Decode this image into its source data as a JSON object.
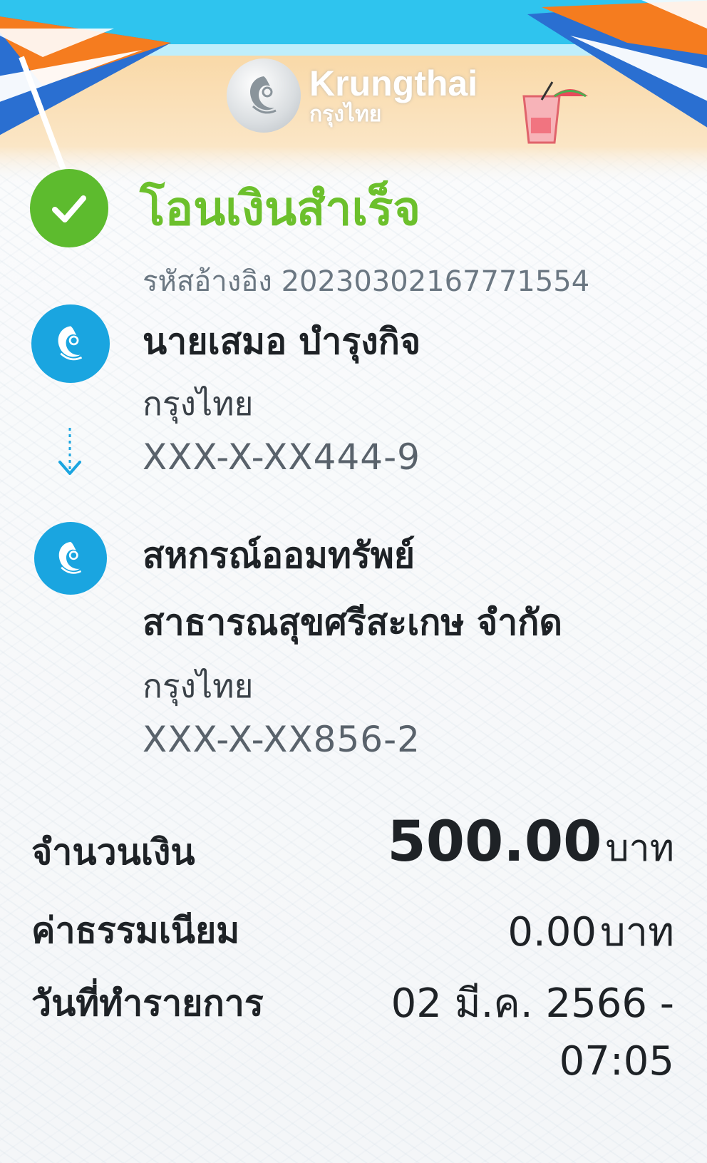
{
  "brand": {
    "name_en": "Krungthai",
    "name_th": "กรุงไทย"
  },
  "status": {
    "title": "โอนเงินสำเร็จ",
    "ref_label": "รหัสอ้างอิง",
    "ref_number": "20230302167771554"
  },
  "sender": {
    "name": "นายเสมอ บำรุงกิจ",
    "bank": "กรุงไทย",
    "account": "XXX-X-XX444-9"
  },
  "receiver": {
    "name_line1": "สหกรณ์ออมทรัพย์",
    "name_line2": "สาธารณสุขศรีสะเกษ จำกัด",
    "bank": "กรุงไทย",
    "account": "XXX-X-XX856-2"
  },
  "summary": {
    "amount_label": "จำนวนเงิน",
    "amount_value": "500.00",
    "amount_unit": "บาท",
    "fee_label": "ค่าธรรมเนียม",
    "fee_value": "0.00",
    "fee_unit": "บาท",
    "date_label": "วันที่ทำรายการ",
    "date_value": "02 มี.ค. 2566 -",
    "time_value": "07:05"
  },
  "icons": {
    "success": "check-circle-icon",
    "bank_logo": "krungthai-bird-icon",
    "transfer_arrow": "arrow-down-icon"
  },
  "colors": {
    "success_green": "#6cc02c",
    "bank_blue": "#1aa5e0",
    "sky": "#2fc4ee",
    "sand": "#f7d8a6",
    "umbrella_orange": "#f57c1f",
    "umbrella_blue": "#2a6fd1"
  }
}
